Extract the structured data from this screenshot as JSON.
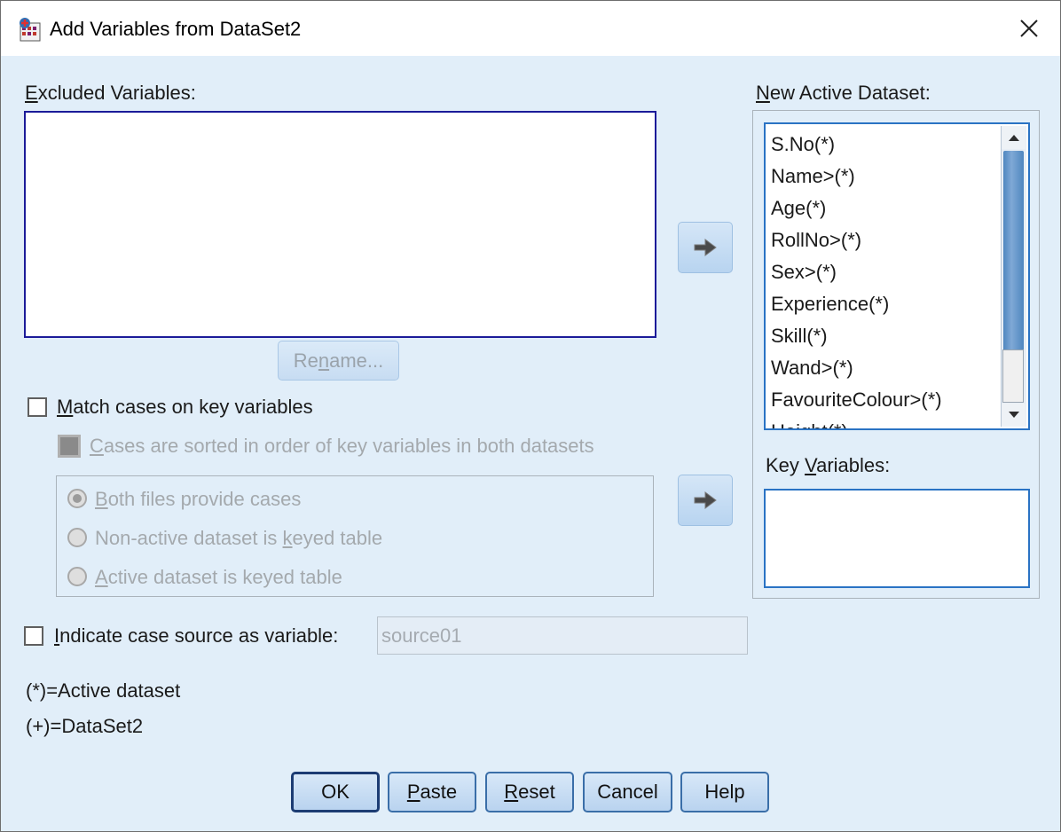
{
  "window": {
    "title": "Add Variables from DataSet2",
    "app_icon": "spss-icon",
    "close_icon": "close-icon"
  },
  "excluded": {
    "label_u": "E",
    "label_rest": "xcluded Variables:",
    "items": []
  },
  "rename_button": {
    "pre": "Re",
    "u": "n",
    "post": "ame..."
  },
  "new_active": {
    "label_u": "N",
    "label_rest": "ew Active Dataset:",
    "items": [
      "S.No(*)",
      "Name>(*)",
      "Age(*)",
      "RollNo>(*)",
      "Sex>(*)",
      "Experience(*)",
      "Skill(*)",
      "Wand>(*)",
      "FavouriteColour>(*)",
      "Height(*)"
    ]
  },
  "key_vars": {
    "pre": "Key ",
    "u": "V",
    "post": "ariables:",
    "items": []
  },
  "match_cases": {
    "u": "M",
    "rest": "atch cases on key variables",
    "checked": false
  },
  "sorted": {
    "u": "C",
    "rest": "ases are sorted in order of key variables in both datasets"
  },
  "radios": [
    {
      "pre": "",
      "u": "B",
      "post": "oth files provide cases",
      "selected": true
    },
    {
      "pre": "Non-active dataset is ",
      "u": "k",
      "post": "eyed table",
      "selected": false
    },
    {
      "pre": "",
      "u": "A",
      "post": "ctive dataset is keyed table",
      "selected": false
    }
  ],
  "indicate_source": {
    "u": "I",
    "rest": "ndicate case source as variable:",
    "value": "source01"
  },
  "legend": [
    "(*)=Active dataset",
    "(+)=DataSet2"
  ],
  "buttons": {
    "ok": "OK",
    "paste": {
      "u": "P",
      "rest": "aste"
    },
    "reset": {
      "u": "R",
      "rest": "eset"
    },
    "cancel": "Cancel",
    "help": "Help"
  },
  "icons": {
    "move_right": "arrow-right-icon"
  }
}
